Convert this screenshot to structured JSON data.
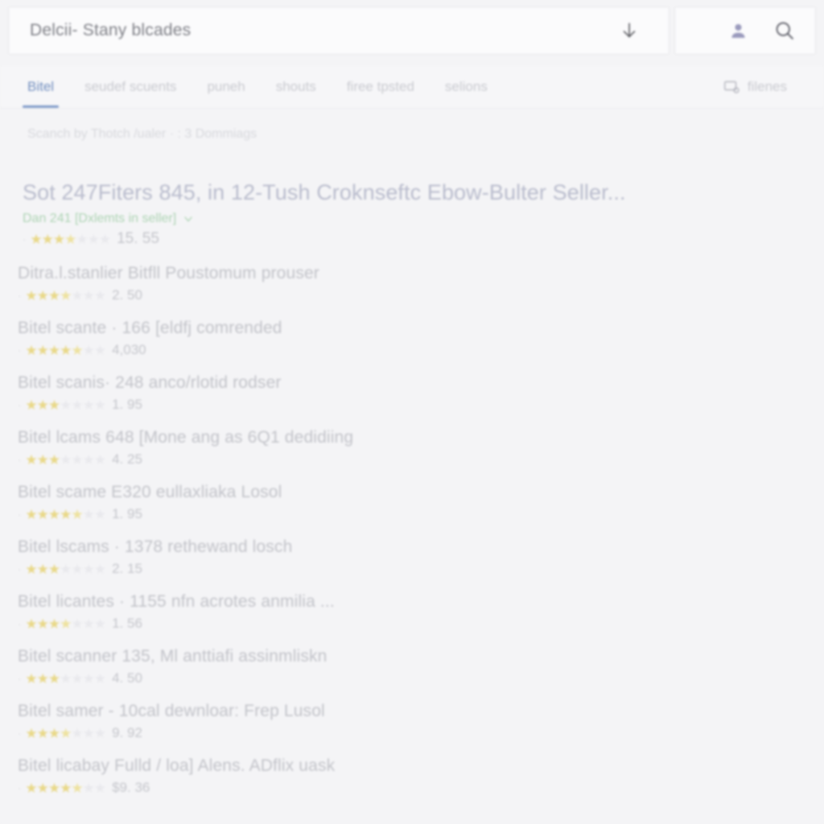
{
  "search": {
    "query": "Delcii- Stany blcades",
    "placeholder": "Delcii- Stany blcades",
    "download_icon": "download-arrow-icon",
    "person_icon": "person-icon",
    "magnifier_icon": "search-icon"
  },
  "tabs": [
    {
      "label": "Bitel",
      "active": true
    },
    {
      "label": "seudef scuents",
      "active": false
    },
    {
      "label": "puneh",
      "active": false
    },
    {
      "label": "shouts",
      "active": false
    },
    {
      "label": "firee tpsted",
      "active": false
    },
    {
      "label": "selions",
      "active": false
    }
  ],
  "tab_right": {
    "label": "filenes",
    "icon": "filter-screen-icon"
  },
  "subtitle": "Scanch by Thotch /ualer · : 3 Dommiags",
  "hero": {
    "title": "Sot 247Fiters 845, in 12-Tush Croknseftc Ebow-Bulter Seller...",
    "seller_line": "Dan 241 [Dxlemts in seller]",
    "chevron": "chevron-down-icon",
    "rating": 3.4,
    "price": "15. 55"
  },
  "results": [
    {
      "title": "Ditra.l.stanlier Bitfll Poustomum prouser",
      "rating": 3.5,
      "price": "2. 50"
    },
    {
      "title": "Bitel scante · 166 [eldfj comrended",
      "rating": 4.6,
      "price": "4,030"
    },
    {
      "title": "Bitel scanis· 248 anco/rlotid rodser",
      "rating": 3.0,
      "price": "1. 95"
    },
    {
      "title": "Bitel lcams  648 [Mone ang as 6Q1 dedidiing",
      "rating": 3.0,
      "price": "4. 25"
    },
    {
      "title": "Bitel scame  E320 eullaxliaka Losol",
      "rating": 4.7,
      "price": "1. 95"
    },
    {
      "title": "Bitel lscams · 1378 rethewand losch",
      "rating": 3.0,
      "price": "2. 15"
    },
    {
      "title": "Bitel licantes · 1155 nfn acrotes anmilia ...",
      "rating": 3.4,
      "price": "1. 56"
    },
    {
      "title": "Bitel scanner 135, Ml anttiafi assinmliskn",
      "rating": 3.0,
      "price": "4. 50"
    },
    {
      "title": "Bitel samer - 10cal dewnloar: Frep Lusol",
      "rating": 3.5,
      "price": "9. 92"
    },
    {
      "title": "Bitel licabay Fulld / loa] Alens. ADflix uask",
      "rating": 4.8,
      "price": "$9. 36"
    }
  ],
  "colors": {
    "page_bg": "#f4f4f6",
    "tab_active": "#6e8fc9",
    "seller_green": "#a8d6b0",
    "star_gold": "#ecd87a",
    "person_purple": "#9a9ac2"
  }
}
